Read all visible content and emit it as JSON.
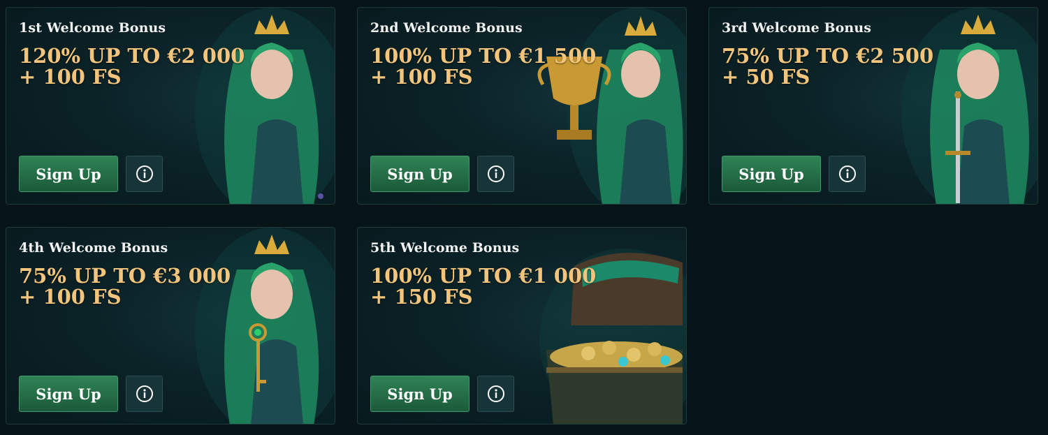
{
  "colors": {
    "page_bg": "#061418",
    "card_bg": "#0b2227",
    "offer_text": "#f3c57c",
    "signup_bg": "#2f8355",
    "info_bg": "#173438"
  },
  "cards": [
    {
      "title": "1st Welcome Bonus",
      "offer_line1": "120% UP TO €2 000",
      "offer_line2": "+ 100 FS",
      "signup_label": "Sign Up",
      "info_icon": "info-circle-icon",
      "art": "elf-queen-illustration"
    },
    {
      "title": "2nd Welcome Bonus",
      "offer_line1": "100% UP TO €1 500",
      "offer_line2": "+ 100 FS",
      "signup_label": "Sign Up",
      "info_icon": "info-circle-icon",
      "art": "elf-queen-with-trophy-illustration"
    },
    {
      "title": "3rd Welcome Bonus",
      "offer_line1": "75% UP TO €2 500",
      "offer_line2": "+ 50 FS",
      "signup_label": "Sign Up",
      "info_icon": "info-circle-icon",
      "art": "elf-queen-with-sword-illustration"
    },
    {
      "title": "4th Welcome Bonus",
      "offer_line1": "75% UP TO €3 000",
      "offer_line2": "+ 100 FS",
      "signup_label": "Sign Up",
      "info_icon": "info-circle-icon",
      "art": "elf-queen-with-key-illustration"
    },
    {
      "title": "5th Welcome Bonus",
      "offer_line1": "100% UP TO €1 000",
      "offer_line2": "+ 150 FS",
      "signup_label": "Sign Up",
      "info_icon": "info-circle-icon",
      "art": "treasure-chest-illustration"
    }
  ]
}
